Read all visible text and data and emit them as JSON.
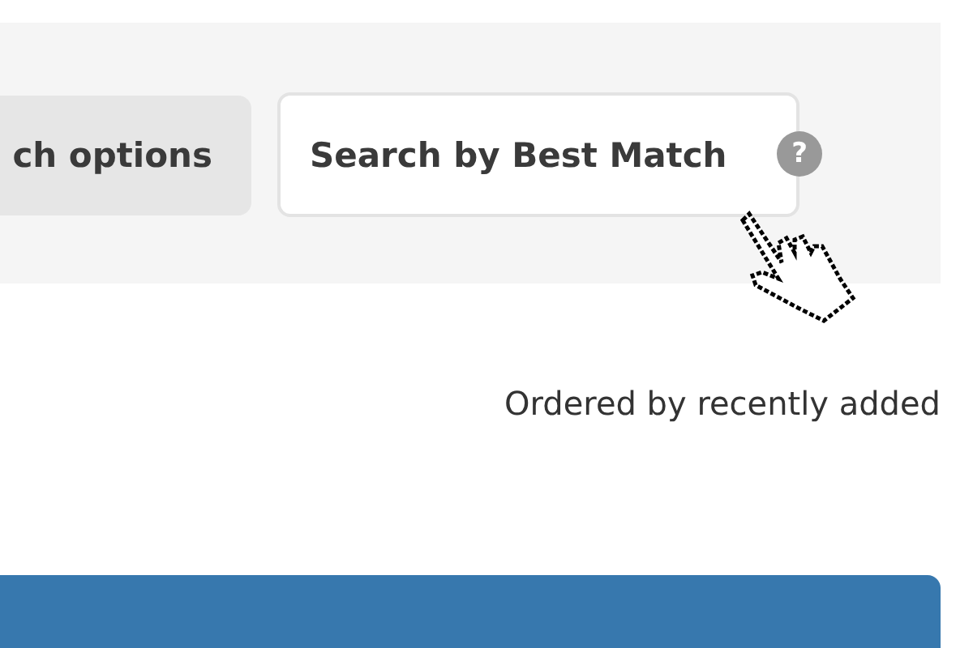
{
  "search_buttons": [
    {
      "label": "ch options",
      "selected": false
    },
    {
      "label": "Search by Best Match",
      "selected": true
    }
  ],
  "help": {
    "label": "?"
  },
  "sort_note": "Ordered by recently added"
}
